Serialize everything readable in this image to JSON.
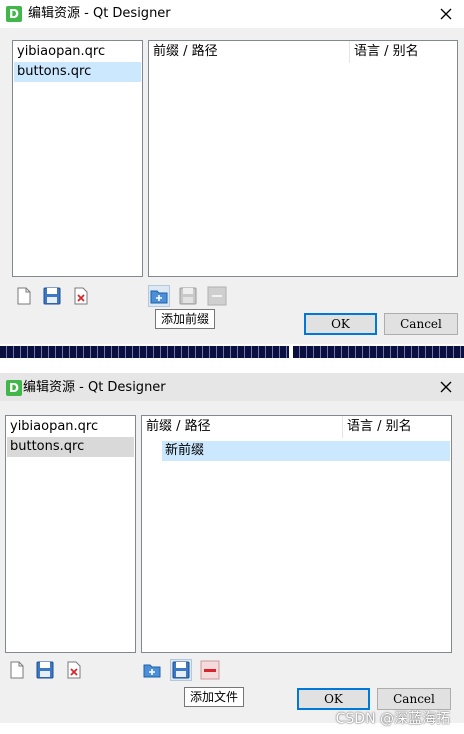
{
  "dialog1": {
    "title": "编辑资源 - Qt Designer",
    "app_icon": "D",
    "files": [
      "yibiaopan.qrc",
      "buttons.qrc"
    ],
    "columns": [
      "前缀 / 路径",
      "语言 / 别名"
    ],
    "tooltip": "添加前缀",
    "ok_label": "OK",
    "cancel_label": "Cancel"
  },
  "dialog2": {
    "title": "编辑资源 - Qt Designer",
    "app_icon": "D",
    "files": [
      "yibiaopan.qrc",
      "buttons.qrc"
    ],
    "columns": [
      "前缀 / 路径",
      "语言 / 别名"
    ],
    "tree_item": "新前缀",
    "tooltip": "添加文件",
    "ok_label": "OK",
    "cancel_label": "Cancel"
  },
  "watermark": "CSDN @深蓝海拓",
  "colors": {
    "selection": "#cce8ff",
    "default_button_border": "#0078d7",
    "app_icon": "#41b649",
    "delete_red": "#d9232d"
  }
}
